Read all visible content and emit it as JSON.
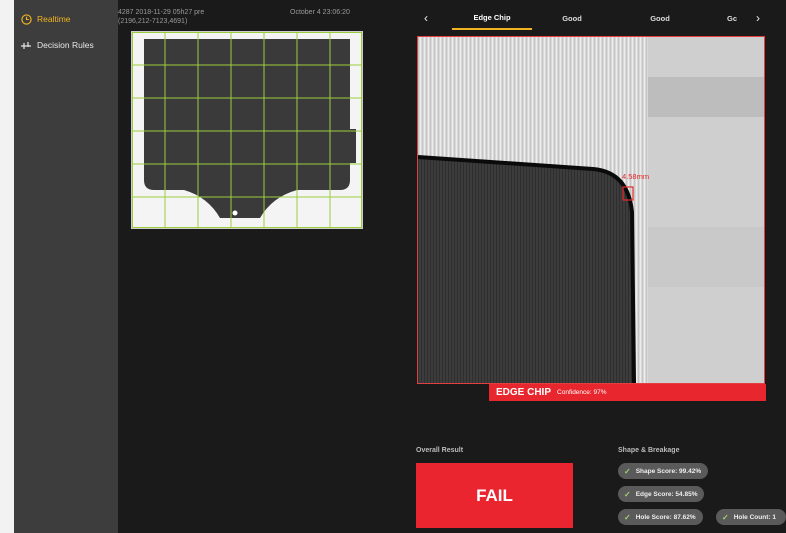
{
  "sidebar": {
    "items": [
      {
        "label": "Realtime",
        "icon": "clock-icon",
        "active": true
      },
      {
        "label": "Decision Rules",
        "icon": "sliders-icon",
        "active": false
      }
    ]
  },
  "sample": {
    "id_line1": "4287 2018-11-29 05h27 pre",
    "id_line2": "(2196,212-7123,4691)",
    "timestamp": "October 4 23:06:20"
  },
  "tabs": {
    "prev_icon": "chevron-left-icon",
    "next_icon": "chevron-right-icon",
    "items": [
      "Edge Chip",
      "Good",
      "Good",
      "Gc"
    ],
    "active_index": 0
  },
  "zoom_view": {
    "measurement": "4.58mm"
  },
  "defect": {
    "label": "EDGE CHIP",
    "confidence": "Confidence: 97%"
  },
  "overall": {
    "title": "Overall Result",
    "result": "FAIL"
  },
  "shape": {
    "title": "Shape & Breakage",
    "scores": [
      "Shape Score: 99.42%",
      "Edge Score: 54.85%",
      "Hole Score: 87.62%",
      "Hole Count: 1"
    ]
  },
  "colors": {
    "accent": "#f0b321",
    "fail": "#ea2530",
    "ok_check": "#9fd36b",
    "grid": "#9ccc3c"
  }
}
